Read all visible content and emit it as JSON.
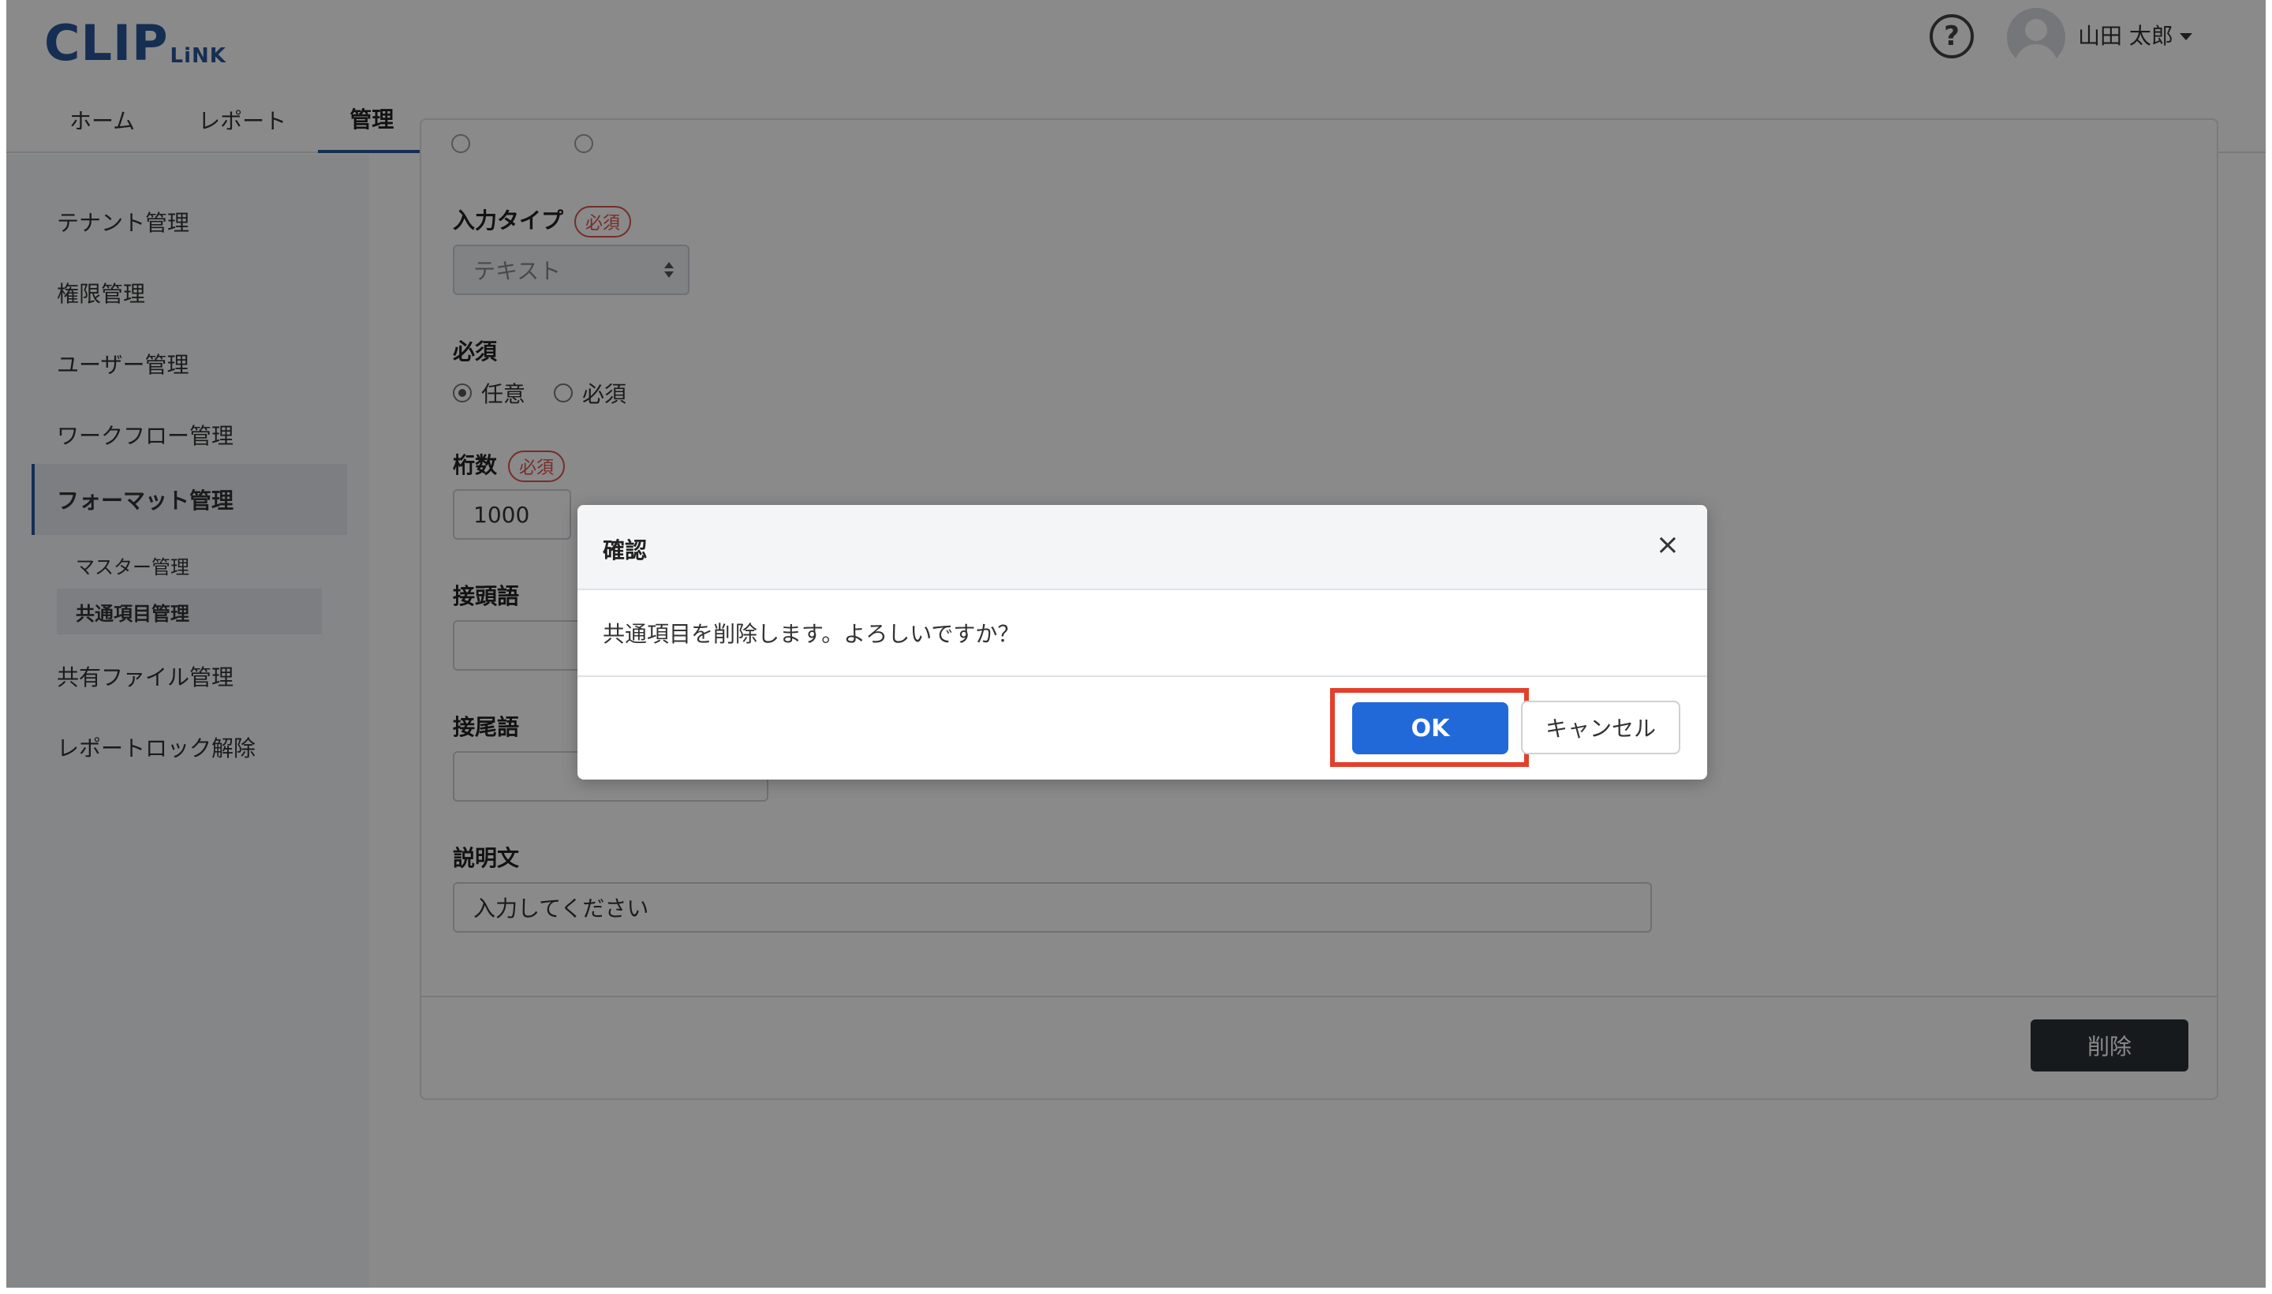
{
  "header": {
    "logo_main": "CLIP",
    "logo_sub": "LiNK",
    "tabs": [
      {
        "label": "ホーム"
      },
      {
        "label": "レポート"
      },
      {
        "label": "管理"
      }
    ],
    "help_icon": "?",
    "user_name": "山田 太郎"
  },
  "sidebar": {
    "items": [
      {
        "label": "テナント管理"
      },
      {
        "label": "権限管理"
      },
      {
        "label": "ユーザー管理"
      },
      {
        "label": "ワークフロー管理"
      },
      {
        "label": "フォーマット管理"
      },
      {
        "label": "共有ファイル管理"
      },
      {
        "label": "レポートロック解除"
      }
    ],
    "subitems": [
      {
        "label": "マスター管理"
      },
      {
        "label": "共通項目管理"
      }
    ]
  },
  "form": {
    "input_type_label": "入力タイプ",
    "required_badge": "必須",
    "input_type_value": "テキスト",
    "required_label": "必須",
    "radio_optional": "任意",
    "radio_required": "必須",
    "digits_label": "桁数",
    "digits_value": "1000",
    "prefix_label": "接頭語",
    "suffix_label": "接尾語",
    "description_label": "説明文",
    "description_placeholder": "入力してください",
    "delete_label": "削除"
  },
  "modal": {
    "title": "確認",
    "close": "×",
    "message": "共通項目を削除します。よろしいですか？",
    "ok_label": "OK",
    "cancel_label": "キャンセル"
  },
  "colors": {
    "brand": "#2a5599",
    "primary_button": "#2169d9",
    "highlight": "#e43f2a",
    "required_badge": "#d9534f",
    "dark_button": "#2b3036"
  }
}
